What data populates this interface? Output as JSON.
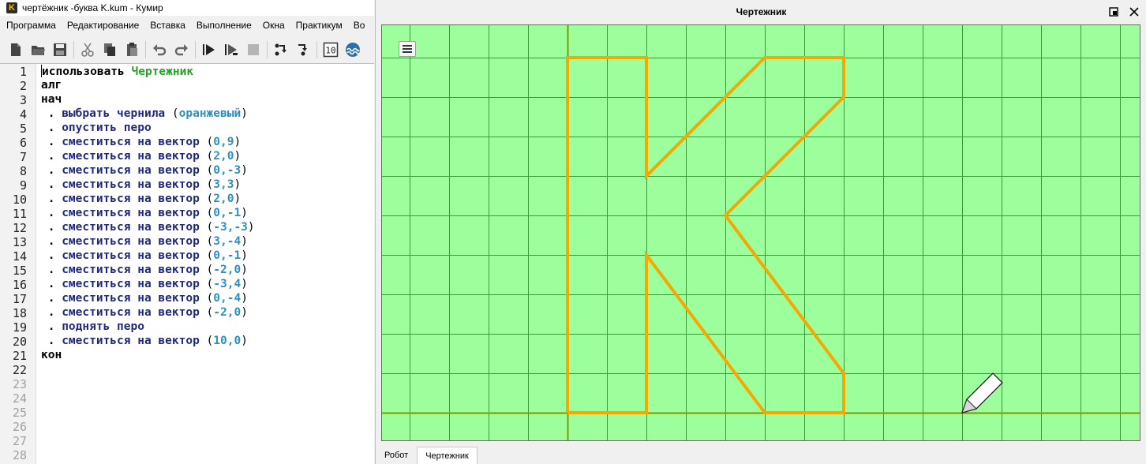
{
  "window": {
    "title": "чертёжник -буква K.kum - Кумир",
    "icon_letter": "K"
  },
  "menu": [
    "Программа",
    "Редактирование",
    "Вставка",
    "Выполнение",
    "Окна",
    "Практикум",
    "Во"
  ],
  "toolbar": {
    "icons": [
      "new-file-icon",
      "open-folder-icon",
      "save-icon",
      "cut-icon",
      "copy-icon",
      "paste-icon",
      "undo-icon",
      "redo-icon",
      "run-icon",
      "step-run-icon",
      "stop-icon",
      "step-into-icon",
      "step-out-icon",
      "counter-icon",
      "wave-icon"
    ],
    "counter_label": "10"
  },
  "editor": {
    "lines": [
      {
        "n": "1",
        "parts": [
          [
            "kw",
            "использовать "
          ],
          [
            "mod",
            "Чертежник"
          ]
        ]
      },
      {
        "n": "2",
        "parts": [
          [
            "kw",
            "алг"
          ]
        ]
      },
      {
        "n": "3",
        "parts": [
          [
            "kw",
            "нач"
          ]
        ]
      },
      {
        "n": "4",
        "parts": [
          [
            "kw",
            " . "
          ],
          [
            "cmd",
            "выбрать чернила "
          ],
          [
            "paren",
            "("
          ],
          [
            "str",
            "оранжевый"
          ],
          [
            "paren",
            ")"
          ]
        ]
      },
      {
        "n": "5",
        "parts": [
          [
            "kw",
            " . "
          ],
          [
            "cmd",
            "опустить перо"
          ]
        ]
      },
      {
        "n": "6",
        "parts": [
          [
            "kw",
            " . "
          ],
          [
            "cmd",
            "сместиться на вектор "
          ],
          [
            "paren",
            "("
          ],
          [
            "num",
            "0,9"
          ],
          [
            "paren",
            ")"
          ]
        ]
      },
      {
        "n": "7",
        "parts": [
          [
            "kw",
            " . "
          ],
          [
            "cmd",
            "сместиться на вектор "
          ],
          [
            "paren",
            "("
          ],
          [
            "num",
            "2,0"
          ],
          [
            "paren",
            ")"
          ]
        ]
      },
      {
        "n": "8",
        "parts": [
          [
            "kw",
            " . "
          ],
          [
            "cmd",
            "сместиться на вектор "
          ],
          [
            "paren",
            "("
          ],
          [
            "num",
            "0,-3"
          ],
          [
            "paren",
            ")"
          ]
        ]
      },
      {
        "n": "9",
        "parts": [
          [
            "kw",
            " . "
          ],
          [
            "cmd",
            "сместиться на вектор "
          ],
          [
            "paren",
            "("
          ],
          [
            "num",
            "3,3"
          ],
          [
            "paren",
            ")"
          ]
        ]
      },
      {
        "n": "10",
        "parts": [
          [
            "kw",
            " . "
          ],
          [
            "cmd",
            "сместиться на вектор "
          ],
          [
            "paren",
            "("
          ],
          [
            "num",
            "2,0"
          ],
          [
            "paren",
            ")"
          ]
        ]
      },
      {
        "n": "11",
        "parts": [
          [
            "kw",
            " . "
          ],
          [
            "cmd",
            "сместиться на вектор "
          ],
          [
            "paren",
            "("
          ],
          [
            "num",
            "0,-1"
          ],
          [
            "paren",
            ")"
          ]
        ]
      },
      {
        "n": "12",
        "parts": [
          [
            "kw",
            " . "
          ],
          [
            "cmd",
            "сместиться на вектор "
          ],
          [
            "paren",
            "("
          ],
          [
            "num",
            "-3,-3"
          ],
          [
            "paren",
            ")"
          ]
        ]
      },
      {
        "n": "13",
        "parts": [
          [
            "kw",
            " . "
          ],
          [
            "cmd",
            "сместиться на вектор "
          ],
          [
            "paren",
            "("
          ],
          [
            "num",
            "3,-4"
          ],
          [
            "paren",
            ")"
          ]
        ]
      },
      {
        "n": "14",
        "parts": [
          [
            "kw",
            " . "
          ],
          [
            "cmd",
            "сместиться на вектор "
          ],
          [
            "paren",
            "("
          ],
          [
            "num",
            "0,-1"
          ],
          [
            "paren",
            ")"
          ]
        ]
      },
      {
        "n": "15",
        "parts": [
          [
            "kw",
            " . "
          ],
          [
            "cmd",
            "сместиться на вектор "
          ],
          [
            "paren",
            "("
          ],
          [
            "num",
            "-2,0"
          ],
          [
            "paren",
            ")"
          ]
        ]
      },
      {
        "n": "16",
        "parts": [
          [
            "kw",
            " . "
          ],
          [
            "cmd",
            "сместиться на вектор "
          ],
          [
            "paren",
            "("
          ],
          [
            "num",
            "-3,4"
          ],
          [
            "paren",
            ")"
          ]
        ]
      },
      {
        "n": "17",
        "parts": [
          [
            "kw",
            " . "
          ],
          [
            "cmd",
            "сместиться на вектор "
          ],
          [
            "paren",
            "("
          ],
          [
            "num",
            "0,-4"
          ],
          [
            "paren",
            ")"
          ]
        ]
      },
      {
        "n": "18",
        "parts": [
          [
            "kw",
            " . "
          ],
          [
            "cmd",
            "сместиться на вектор "
          ],
          [
            "paren",
            "("
          ],
          [
            "num",
            "-2,0"
          ],
          [
            "paren",
            ")"
          ]
        ]
      },
      {
        "n": "19",
        "parts": [
          [
            "kw",
            " . "
          ],
          [
            "cmd",
            "поднять перо"
          ]
        ]
      },
      {
        "n": "20",
        "parts": [
          [
            "kw",
            " . "
          ],
          [
            "cmd",
            "сместиться на вектор "
          ],
          [
            "paren",
            "("
          ],
          [
            "num",
            "10,0"
          ],
          [
            "paren",
            ")"
          ]
        ]
      },
      {
        "n": "21",
        "parts": [
          [
            "kw",
            "кон"
          ]
        ]
      },
      {
        "n": "22",
        "parts": []
      },
      {
        "n": "23",
        "parts": []
      },
      {
        "n": "24",
        "parts": []
      },
      {
        "n": "25",
        "parts": []
      },
      {
        "n": "26",
        "parts": []
      },
      {
        "n": "27",
        "parts": []
      },
      {
        "n": "28",
        "parts": []
      }
    ],
    "active_line_count": 22
  },
  "drawer": {
    "title": "Чертежник",
    "tabs": [
      "Робот",
      "Чертежник"
    ],
    "active_tab": "Чертежник",
    "ink_color": "#f5a800",
    "field_color": "#9cff9c",
    "grid_color": "#4a8a6a",
    "axis_color": "#7a9a00",
    "grid_x_range": [
      -5,
      14
    ],
    "grid_y_range": [
      -1,
      9
    ],
    "origin": [
      0,
      0
    ],
    "moves": [
      [
        0,
        9
      ],
      [
        2,
        0
      ],
      [
        0,
        -3
      ],
      [
        3,
        3
      ],
      [
        2,
        0
      ],
      [
        0,
        -1
      ],
      [
        -3,
        -3
      ],
      [
        3,
        -4
      ],
      [
        0,
        -1
      ],
      [
        -2,
        0
      ],
      [
        -3,
        4
      ],
      [
        0,
        -4
      ],
      [
        -2,
        0
      ]
    ],
    "pen_position": [
      10,
      0
    ]
  }
}
